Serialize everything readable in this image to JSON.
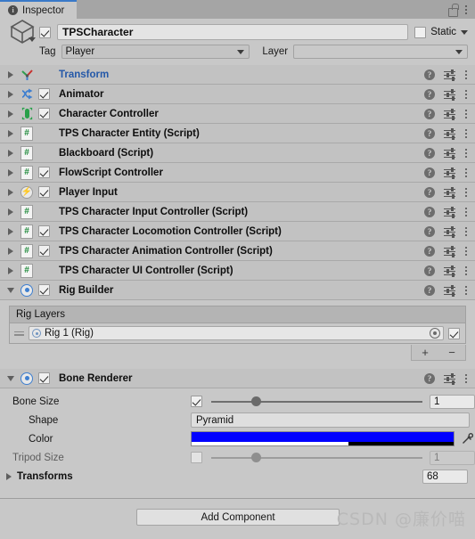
{
  "window": {
    "tab_label": "Inspector",
    "tab_icon": "info-icon",
    "lock_icon": "lock-open-icon",
    "menu_icon": "kebab-menu-icon"
  },
  "gameobject": {
    "icon": "cube-icon",
    "enabled": true,
    "name": "TPSCharacter",
    "static_label": "Static",
    "static_checked": false,
    "tag_label": "Tag",
    "tag_value": "Player",
    "layer_label": "Layer",
    "layer_value": ""
  },
  "components": [
    {
      "name": "Transform",
      "icon": "transform-axis-icon",
      "expanded": false,
      "has_checkbox": false,
      "checked": false,
      "is_link": true
    },
    {
      "name": "Animator",
      "icon": "animator-icon",
      "expanded": false,
      "has_checkbox": true,
      "checked": true,
      "is_link": false
    },
    {
      "name": "Character Controller",
      "icon": "character-controller-capsule-icon",
      "expanded": false,
      "has_checkbox": true,
      "checked": true,
      "is_link": false
    },
    {
      "name": "TPS Character Entity (Script)",
      "icon": "script-icon",
      "expanded": false,
      "has_checkbox": false,
      "checked": false,
      "is_link": false
    },
    {
      "name": "Blackboard (Script)",
      "icon": "script-icon",
      "expanded": false,
      "has_checkbox": false,
      "checked": false,
      "is_link": false
    },
    {
      "name": "FlowScript Controller",
      "icon": "script-icon",
      "expanded": false,
      "has_checkbox": true,
      "checked": true,
      "is_link": false
    },
    {
      "name": "Player Input",
      "icon": "player-input-bolt-icon",
      "expanded": false,
      "has_checkbox": true,
      "checked": true,
      "is_link": false
    },
    {
      "name": "TPS Character Input Controller (Script)",
      "icon": "script-icon",
      "expanded": false,
      "has_checkbox": false,
      "checked": false,
      "is_link": false
    },
    {
      "name": "TPS Character Locomotion Controller (Script)",
      "icon": "script-icon",
      "expanded": false,
      "has_checkbox": true,
      "checked": true,
      "is_link": false
    },
    {
      "name": "TPS Character Animation Controller (Script)",
      "icon": "script-icon",
      "expanded": false,
      "has_checkbox": true,
      "checked": true,
      "is_link": false
    },
    {
      "name": "TPS Character UI Controller (Script)",
      "icon": "script-icon",
      "expanded": false,
      "has_checkbox": false,
      "checked": false,
      "is_link": false
    }
  ],
  "row_tools": {
    "help_icon": "help-icon",
    "preset_icon": "preset-settings-icon",
    "menu_icon": "kebab-menu-icon"
  },
  "rig_builder": {
    "name": "Rig Builder",
    "icon": "rig-builder-icon",
    "expanded": true,
    "checked": true,
    "list_header": "Rig Layers",
    "layers": [
      {
        "value": "Rig 1 (Rig)",
        "icon": "rig-asset-icon",
        "enabled": true
      }
    ],
    "add_label": "+",
    "remove_label": "−"
  },
  "bone_renderer": {
    "name": "Bone Renderer",
    "icon": "bone-renderer-icon",
    "expanded": true,
    "checked": true,
    "properties": {
      "bone_size": {
        "label": "Bone Size",
        "checked": true,
        "value": "1",
        "slider_percent": 21,
        "enabled": true
      },
      "shape": {
        "label": "Shape",
        "value": "Pyramid"
      },
      "color": {
        "label": "Color",
        "hex": "#0000FF",
        "alpha_percent": 60
      },
      "tripod_size": {
        "label": "Tripod Size",
        "checked": false,
        "value": "1",
        "slider_percent": 21,
        "enabled": false
      },
      "transforms": {
        "label": "Transforms",
        "count": "68",
        "expanded": false
      }
    }
  },
  "footer": {
    "add_component_label": "Add Component",
    "watermark": "CSDN @廉价喵"
  }
}
